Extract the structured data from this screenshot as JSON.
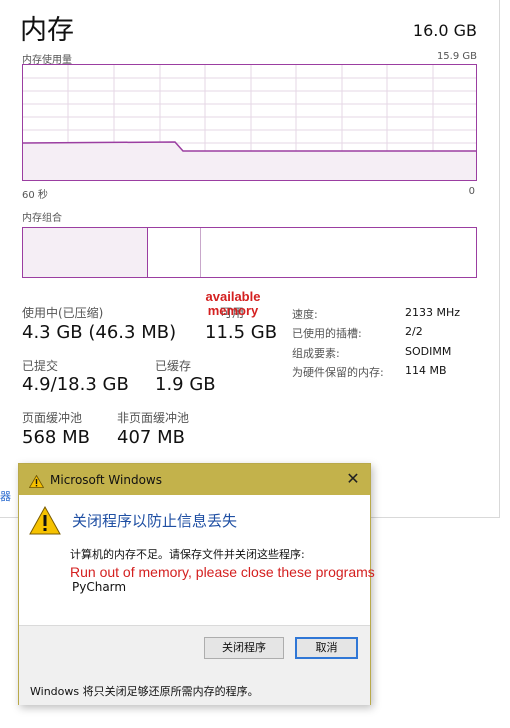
{
  "panel": {
    "title": "内存",
    "total": "16.0 GB",
    "graph_label": "内存使用量",
    "graph_max": "15.9 GB",
    "axis_left": "60 秒",
    "axis_right": "0",
    "composition_label": "内存组合",
    "stats": {
      "in_use_label": "使用中(已压缩)",
      "in_use_value": "4.3 GB (46.3 MB)",
      "available_label": "可用",
      "available_value": "11.5 GB",
      "committed_label": "已提交",
      "committed_value": "4.9/18.3 GB",
      "cached_label": "已缓存",
      "cached_value": "1.9 GB",
      "paged_label": "页面缓冲池",
      "paged_value": "568 MB",
      "nonpaged_label": "非页面缓冲池",
      "nonpaged_value": "407 MB"
    },
    "specs": [
      {
        "label": "速度:",
        "value": "2133 MHz"
      },
      {
        "label": "已使用的插槽:",
        "value": "2/2"
      },
      {
        "label": "组成要素:",
        "value": "SODIMM"
      },
      {
        "label": "为硬件保留的内存:",
        "value": "114 MB"
      }
    ],
    "annotation": "available memory",
    "edge_text": "器"
  },
  "dialog": {
    "title": "Microsoft Windows",
    "heading": "关闭程序以防止信息丢失",
    "body": "计算机的内存不足。请保存文件并关闭这些程序:",
    "annotation": "Run out of memory, please close these programs",
    "program": "PyCharm",
    "close_button": "关闭程序",
    "cancel_button": "取消",
    "note": "Windows 将只关闭足够还原所需内存的程序。"
  },
  "colors": {
    "accent": "#9b3ea1",
    "dialog_titlebar": "#c3b24b",
    "heading": "#1f4fa3",
    "annotation": "#d42020"
  }
}
